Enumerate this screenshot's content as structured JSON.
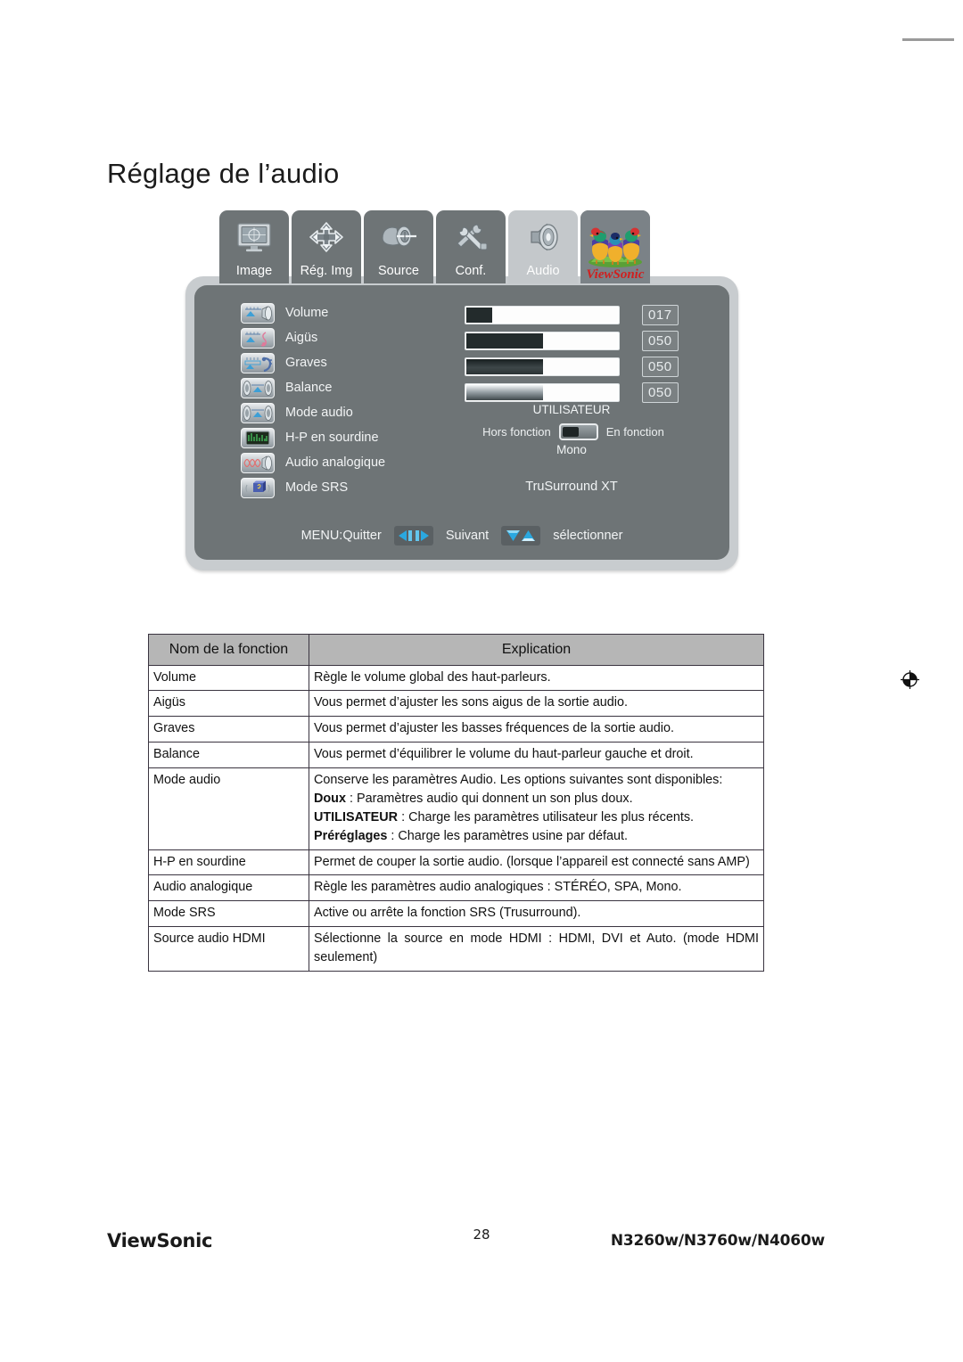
{
  "page": {
    "title": "Réglage de l’audio"
  },
  "osd": {
    "tabs": [
      {
        "label": "Image",
        "icon": "monitor-icon",
        "active": false
      },
      {
        "label": "Rég. Img",
        "icon": "four-arrows-icon",
        "active": false
      },
      {
        "label": "Source",
        "icon": "connector-icon",
        "active": false
      },
      {
        "label": "Conf.",
        "icon": "tools-icon",
        "active": false
      },
      {
        "label": "Audio",
        "icon": "speaker-icon",
        "active": true
      },
      {
        "label": "ViewSonic",
        "icon": "viewsonic-birds-logo",
        "active": false
      }
    ],
    "settings": [
      {
        "label": "Volume",
        "icon": "volume-speaker-icon"
      },
      {
        "label": "Aigüs",
        "icon": "treble-note-icon"
      },
      {
        "label": "Graves",
        "icon": "bass-clef-icon"
      },
      {
        "label": "Balance",
        "icon": "balance-speakers-icon"
      },
      {
        "label": "Mode audio",
        "icon": "audio-mode-speakers-icon"
      },
      {
        "label": "H-P en sourdine",
        "icon": "mute-equalizer-icon"
      },
      {
        "label": "Audio analogique",
        "icon": "analog-wave-icon"
      },
      {
        "label": "Mode SRS",
        "icon": "srs-cube-icon"
      }
    ],
    "sliders": [
      {
        "name": "Volume",
        "value": "017",
        "percent": 17,
        "style": "solid"
      },
      {
        "name": "Aigüs",
        "value": "050",
        "percent": 50,
        "style": "solid"
      },
      {
        "name": "Graves",
        "value": "050",
        "percent": 50,
        "style": "grad"
      },
      {
        "name": "Balance",
        "value": "050",
        "percent": 50,
        "style": "light"
      }
    ],
    "audio_mode_value": "UTILISATEUR",
    "mute_off_label": "Hors fonction",
    "mute_on_label": "En fonction",
    "mute_state": "off",
    "analog_audio_value": "Mono",
    "srs_value": "TruSurround XT",
    "nav": {
      "exit_label": "MENU:Quitter",
      "next_label": "Suivant",
      "select_label": "sélectionner",
      "left_right_icon": "left-right-arrows-icon",
      "up_down_icon": "up-down-triangles-icon"
    }
  },
  "table": {
    "headers": [
      "Nom de la fonction",
      "Explication"
    ],
    "rows": [
      {
        "name": "Volume",
        "explanation": "Règle le volume global des haut-parleurs."
      },
      {
        "name": "Aigüs",
        "explanation": "Vous permet d’ajuster les sons aigus de la sortie audio."
      },
      {
        "name": "Graves",
        "explanation": "Vous permet d’ajuster les basses fréquences de la sortie audio."
      },
      {
        "name": "Balance",
        "explanation": "Vous permet d’équilibrer le volume du haut-parleur gauche et droit."
      },
      {
        "name": "Mode audio",
        "explanation_lines": [
          {
            "text": "Conserve les paramètres Audio. Les options suivantes sont disponibles:"
          },
          {
            "bold": "Doux",
            "text": " : Paramètres audio qui donnent un son plus doux."
          },
          {
            "bold": "UTILISATEUR",
            "text": " : Charge les paramètres utilisateur les plus récents."
          },
          {
            "bold": "Préréglages",
            "text": " : Charge les paramètres usine par défaut."
          }
        ]
      },
      {
        "name": "H-P en sourdine",
        "explanation": "Permet de couper la sortie audio. (lorsque l’appareil est connecté sans AMP)"
      },
      {
        "name": "Audio analogique",
        "explanation": "Règle les paramètres audio analogiques : STÉRÉO, SPA, Mono."
      },
      {
        "name": "Mode SRS",
        "explanation": "Active ou arrête la fonction SRS (Trusurround)."
      },
      {
        "name": "Source audio HDMI",
        "explanation": "Sélectionne la source en mode HDMI : HDMI, DVI et Auto. (mode HDMI seulement)"
      }
    ]
  },
  "footer": {
    "brand": "ViewSonic",
    "page_number": "28",
    "models": "N3260w/N3760w/N4060w"
  },
  "colors": {
    "osd_panel": "#6e7476",
    "osd_frame": "#c8cccf",
    "tab_active": "#c4c8cb",
    "accent_blue": "#2aa8e0",
    "table_header": "#b6b6b6"
  }
}
